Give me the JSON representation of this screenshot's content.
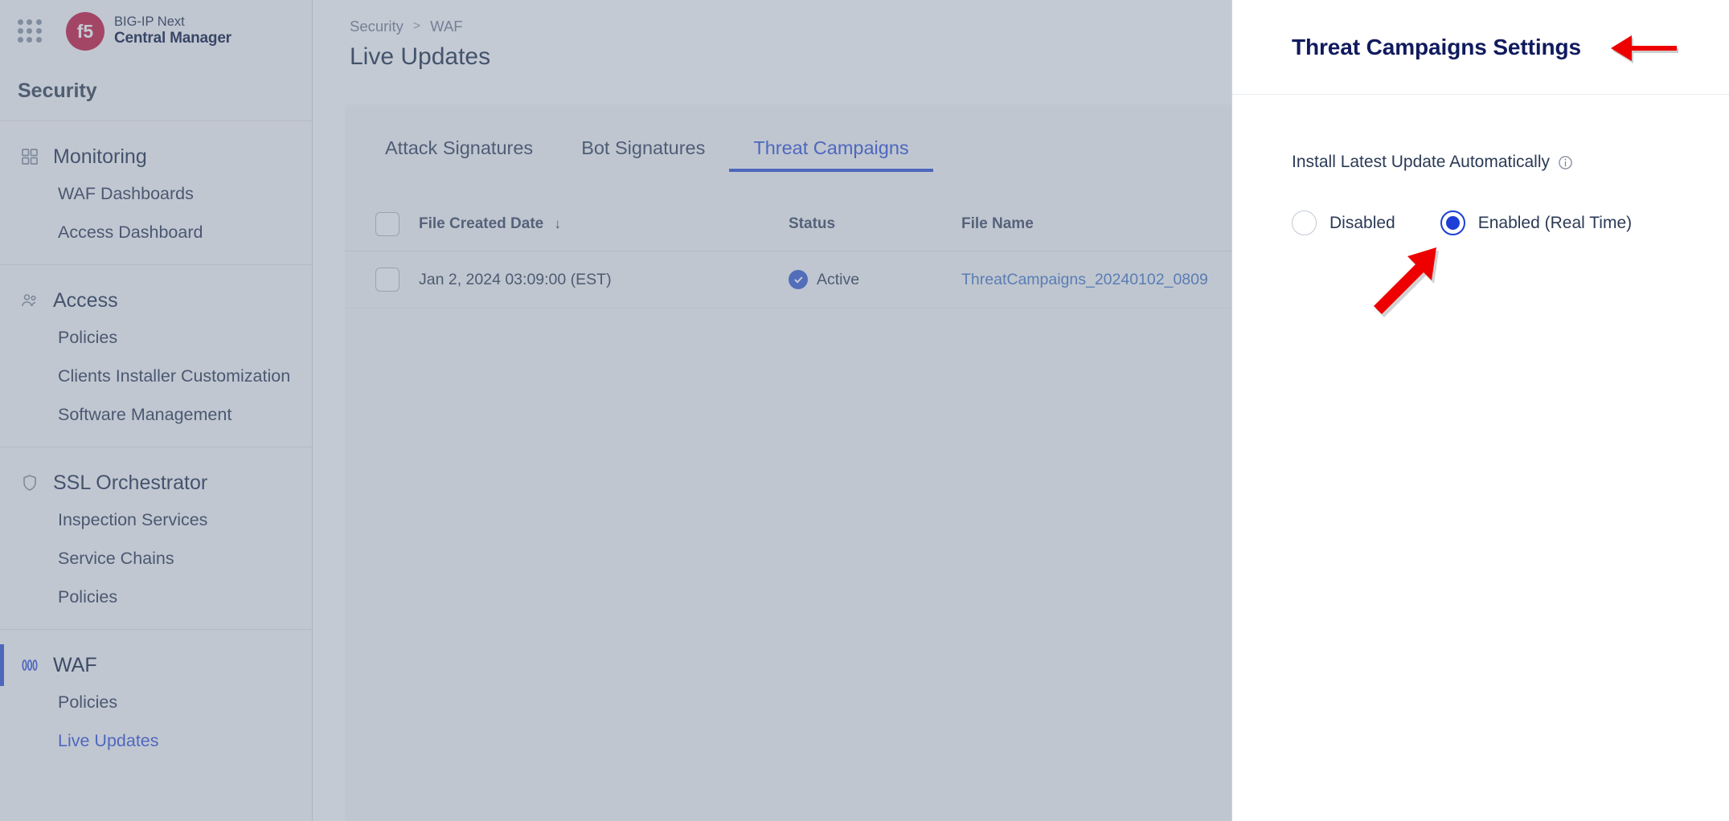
{
  "brand": {
    "product_line": "BIG-IP Next",
    "product_name": "Central Manager",
    "app_grid_icon": "apps-grid-icon",
    "logo_text": "f5"
  },
  "sidebar": {
    "section_title": "Security",
    "groups": [
      {
        "label": "Monitoring",
        "icon": "dashboard-grid-icon",
        "active": false,
        "items": [
          {
            "label": "WAF Dashboards",
            "current": false
          },
          {
            "label": "Access Dashboard",
            "current": false
          }
        ]
      },
      {
        "label": "Access",
        "icon": "users-icon",
        "active": false,
        "items": [
          {
            "label": "Policies",
            "current": false
          },
          {
            "label": "Clients Installer Customization",
            "current": false
          },
          {
            "label": "Software Management",
            "current": false
          }
        ]
      },
      {
        "label": "SSL Orchestrator",
        "icon": "shield-icon",
        "active": false,
        "items": [
          {
            "label": "Inspection Services",
            "current": false
          },
          {
            "label": "Service Chains",
            "current": false
          },
          {
            "label": "Policies",
            "current": false
          }
        ]
      },
      {
        "label": "WAF",
        "icon": "waf-bars-icon",
        "active": true,
        "items": [
          {
            "label": "Policies",
            "current": false
          },
          {
            "label": "Live Updates",
            "current": true
          }
        ]
      }
    ]
  },
  "header": {
    "breadcrumb": [
      "Security",
      "WAF"
    ],
    "breadcrumb_separator": ">",
    "page_title": "Live Updates"
  },
  "tabs": [
    {
      "label": "Attack Signatures",
      "active": false
    },
    {
      "label": "Bot Signatures",
      "active": false
    },
    {
      "label": "Threat Campaigns",
      "active": true
    }
  ],
  "table": {
    "columns": [
      {
        "key": "checkbox",
        "label": ""
      },
      {
        "key": "date",
        "label": "File Created Date",
        "sorted": true,
        "sort_direction": "desc"
      },
      {
        "key": "status",
        "label": "Status"
      },
      {
        "key": "filename",
        "label": "File Name"
      }
    ],
    "sort_arrow_glyph": "↓",
    "rows": [
      {
        "date": "Jan 2, 2024 03:09:00 (EST)",
        "status": "Active",
        "status_icon": "check-circle-icon",
        "filename": "ThreatCampaigns_20240102_0809"
      }
    ]
  },
  "panel": {
    "title": "Threat Campaigns Settings",
    "setting_label": "Install Latest Update Automatically",
    "info_icon": "info-circle-icon",
    "options": [
      {
        "label": "Disabled",
        "selected": false
      },
      {
        "label": "Enabled (Real Time)",
        "selected": true
      }
    ]
  },
  "annotations": {
    "arrow_color": "#ee0000",
    "arrow_to_title": "arrow pointing left at panel title",
    "arrow_to_radio": "arrow pointing up-right at enabled radio"
  },
  "colors": {
    "accent_blue": "#3b5bdb",
    "link_blue": "#4f7fc9",
    "title_navy": "#101a5e",
    "status_blue": "#4267d6",
    "brand_red": "#c9234a",
    "annotation_red": "#ee0000"
  }
}
